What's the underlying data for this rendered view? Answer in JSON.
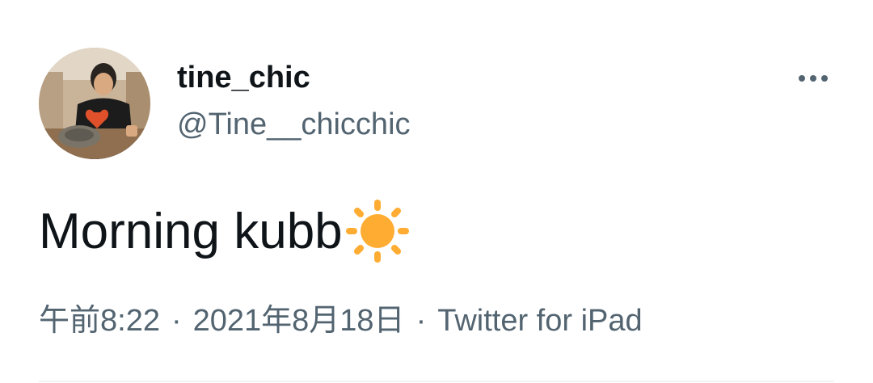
{
  "tweet": {
    "display_name": "tine_chic",
    "handle": "@Tine__chicchic",
    "text": "Morning kubb",
    "emoji": "sun-icon",
    "time": "午前8:22",
    "separator": "·",
    "date": "2021年8月18日",
    "source": "Twitter for iPad"
  },
  "icons": {
    "more": "more-horizontal-icon",
    "sun": "sun-icon"
  },
  "colors": {
    "primary_text": "#0f1419",
    "secondary_text": "#536471",
    "sun": "#ffac33",
    "divider": "#eff3f4"
  }
}
